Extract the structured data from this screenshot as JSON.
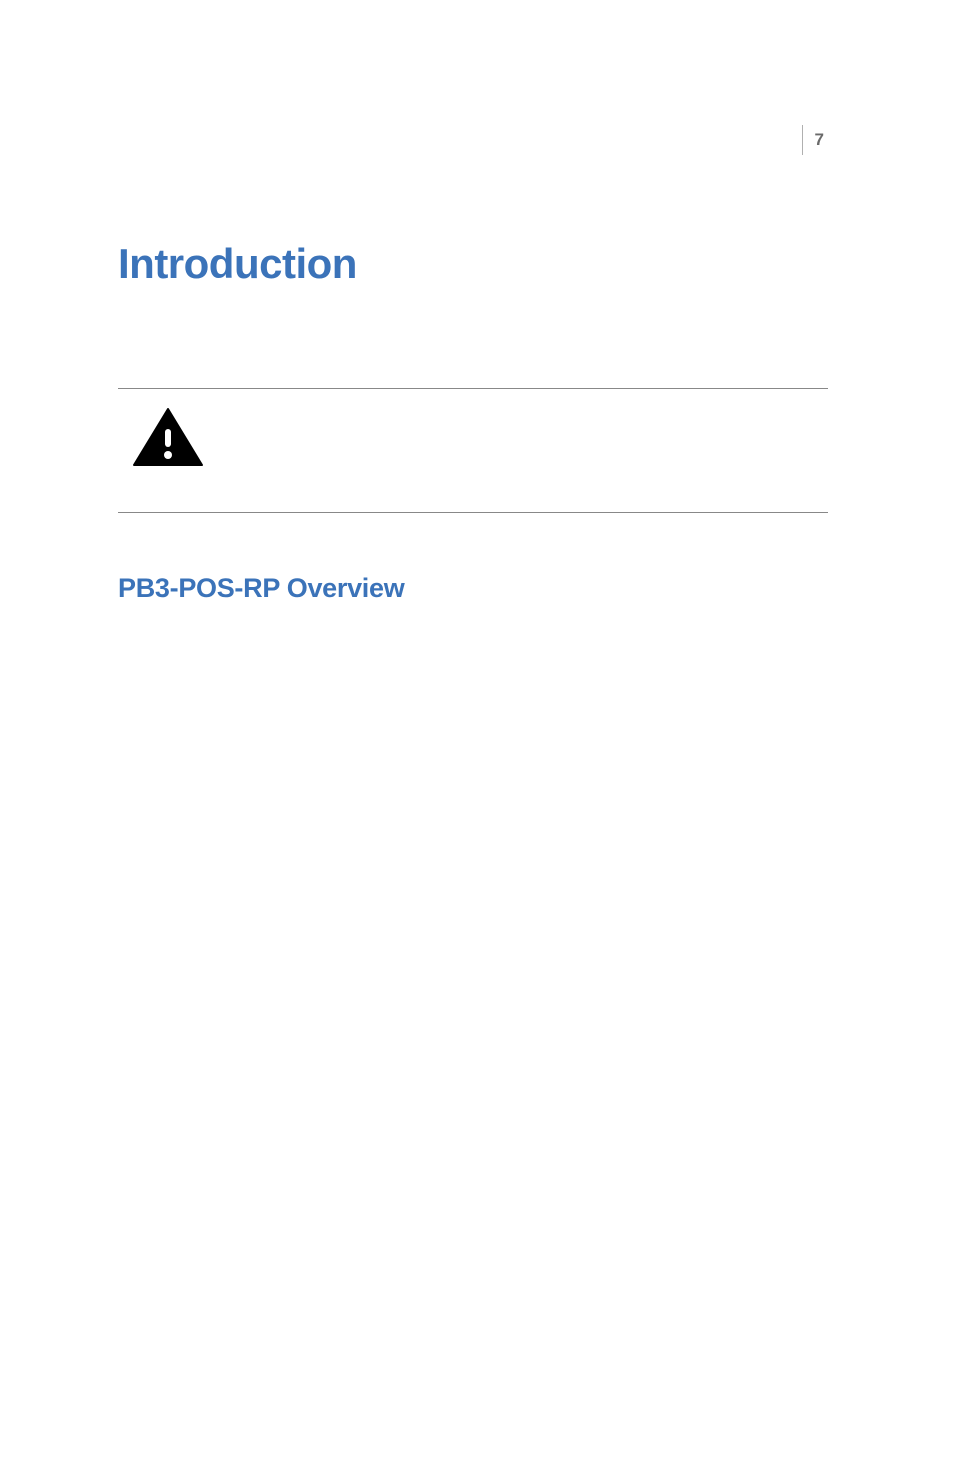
{
  "page": {
    "number": "7"
  },
  "headings": {
    "main": "Introduction",
    "sub": "PB3-POS-RP Overview"
  }
}
